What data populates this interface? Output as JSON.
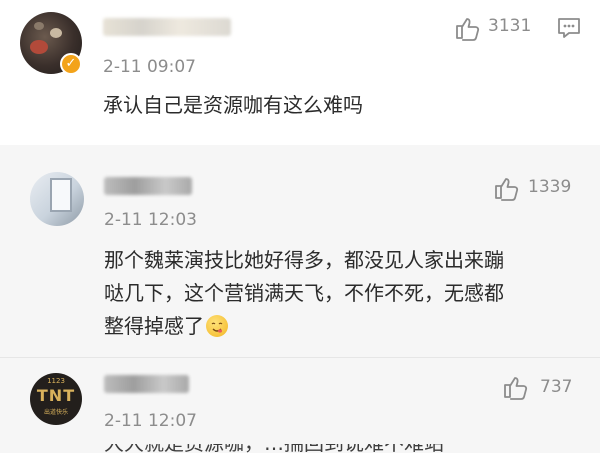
{
  "comments": [
    {
      "time": "2-11 09:07",
      "likes": "3131",
      "text": "承认自己是资源咖有这么难吗"
    },
    {
      "time": "2-11 12:03",
      "likes": "1339",
      "text_lines": [
        "那个魏莱演技比她好得多，都没见人家出来蹦",
        "哒几下，这个营销满天飞，不作不死，无感都",
        "整得掉感了"
      ]
    },
    {
      "time": "2-11 12:07",
      "likes": "737",
      "avatar_text": {
        "number": "1123",
        "logo": "TNT",
        "caption": "出道快乐"
      },
      "text_partial": "大大就是资源咖，…揣回到说难不难站"
    }
  ],
  "icons": {
    "like": "thumbs-up-icon",
    "more": "message-menu-icon",
    "verified": "verified-badge-icon"
  },
  "colors": {
    "meta_gray": "#8c8c8c",
    "text": "#2b2b2b",
    "badge": "#f3a31a",
    "reply_bg": "#f6f6f6"
  }
}
